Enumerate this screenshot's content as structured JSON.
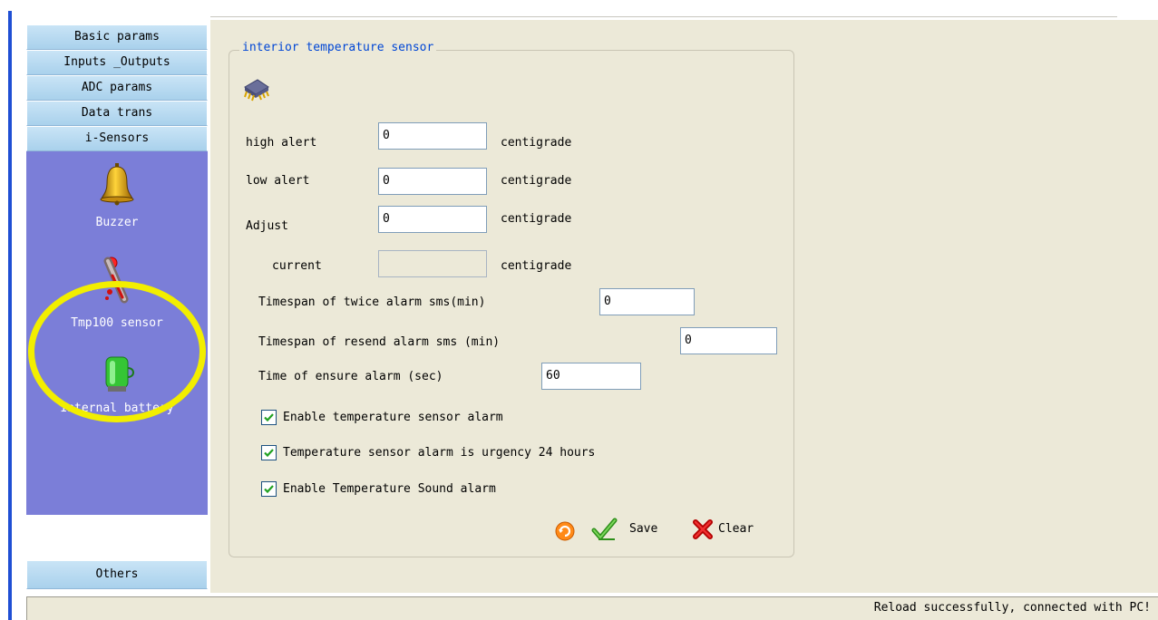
{
  "sidebar": {
    "buttons": [
      {
        "label": "Basic params"
      },
      {
        "label": "Inputs _Outputs"
      },
      {
        "label": "ADC params"
      },
      {
        "label": "Data trans"
      },
      {
        "label": "i-Sensors"
      }
    ],
    "panel_items": [
      {
        "label": "Buzzer",
        "icon": "bell-icon"
      },
      {
        "label": "Tmp100 sensor",
        "icon": "thermometer-icon",
        "highlighted": true
      },
      {
        "label": "Internal battery",
        "icon": "battery-icon"
      }
    ],
    "others_label": "Others"
  },
  "group": {
    "title": "interior temperature sensor",
    "icon": "chip-icon",
    "fields": [
      {
        "label": "high alert",
        "value": "0",
        "unit": "centigrade"
      },
      {
        "label": "low alert",
        "value": "0",
        "unit": "centigrade"
      },
      {
        "label": "Adjust",
        "value": "0",
        "unit": "centigrade"
      },
      {
        "label": "current",
        "value": "",
        "unit": "centigrade",
        "disabled": true
      }
    ],
    "timespan_twice": {
      "label": "Timespan of twice alarm sms(min)",
      "value": "0"
    },
    "timespan_resend": {
      "label": "Timespan of resend alarm sms (min)",
      "value": "0"
    },
    "ensure_alarm": {
      "label": "Time of ensure alarm (sec)",
      "value": "60"
    },
    "checkboxes": [
      {
        "label": "Enable temperature sensor alarm",
        "checked": true
      },
      {
        "label": "Temperature sensor alarm is urgency 24 hours",
        "checked": true
      },
      {
        "label": "Enable Temperature Sound alarm",
        "checked": true
      }
    ],
    "actions": {
      "reload_icon": "reload-icon",
      "save_label": "Save",
      "clear_label": "Clear"
    }
  },
  "status": {
    "text": "Reload successfully, connected with PC!"
  },
  "colors": {
    "accent_blue": "#0046d5",
    "sidebar_panel": "#7b7ed8",
    "highlight_ring": "#f2ee00",
    "window_bg": "#ece9d8"
  }
}
